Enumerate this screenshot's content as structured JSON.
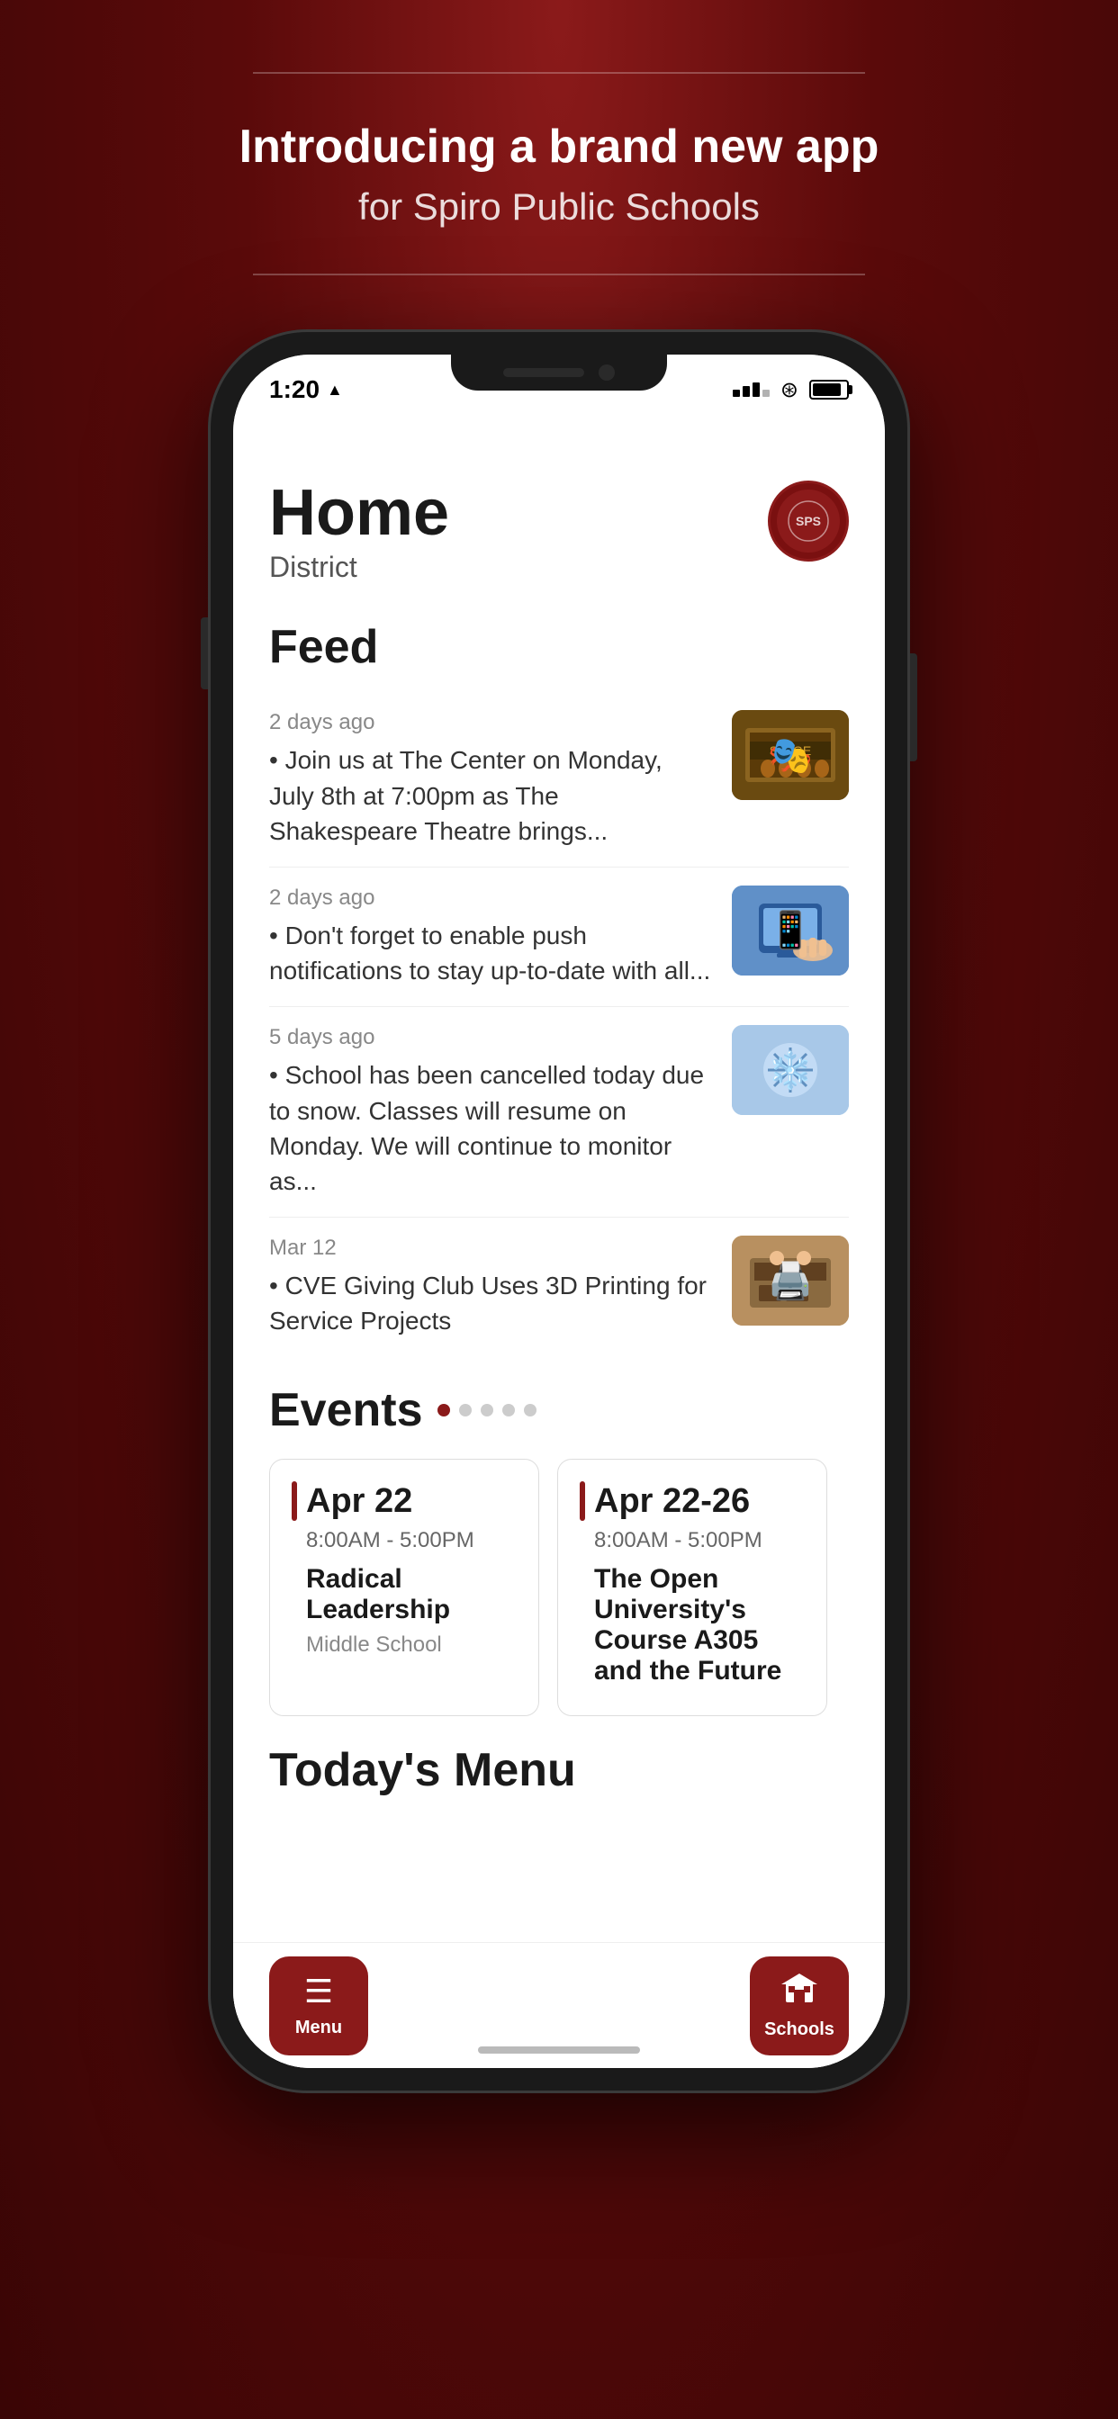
{
  "header": {
    "intro_bold": "Introducing a brand new app",
    "intro_sub": "for Spiro Public Schools"
  },
  "status_bar": {
    "time": "1:20",
    "signal_label": "signal",
    "wifi_label": "wifi",
    "battery_label": "battery"
  },
  "home_screen": {
    "title": "Home",
    "subtitle": "District",
    "logo_alt": "school-logo"
  },
  "feed": {
    "section_label": "Feed",
    "items": [
      {
        "meta": "2 days ago",
        "body": "Join us at The Center on Monday, July 8th at 7:00pm as The Shakespeare Theatre brings...",
        "thumb_type": "theater"
      },
      {
        "meta": "2 days ago",
        "body": "Don't forget to enable push notifications to stay up-to-date with all...",
        "thumb_type": "tech"
      },
      {
        "meta": "5 days ago",
        "body": "School has been cancelled today due to snow. Classes will resume on Monday. We will continue to monitor as...",
        "thumb_type": "snow"
      },
      {
        "meta": "Mar 12",
        "body": "CVE Giving Club Uses 3D Printing for Service Projects",
        "thumb_type": "cve"
      }
    ]
  },
  "events": {
    "section_label": "Events",
    "cards": [
      {
        "date": "Apr 22",
        "time": "8:00AM  -  5:00PM",
        "name": "Radical Leadership",
        "location": "Middle School"
      },
      {
        "date": "Apr 22-26",
        "time": "8:00AM  -  5:00PM",
        "name": "The Open University's Course A305 and the Future",
        "location": ""
      }
    ]
  },
  "menu": {
    "section_label": "Today's Menu"
  },
  "bottom_nav": {
    "menu_label": "Menu",
    "schools_label": "Schools",
    "menu_icon": "☰",
    "schools_icon": "🏫"
  }
}
